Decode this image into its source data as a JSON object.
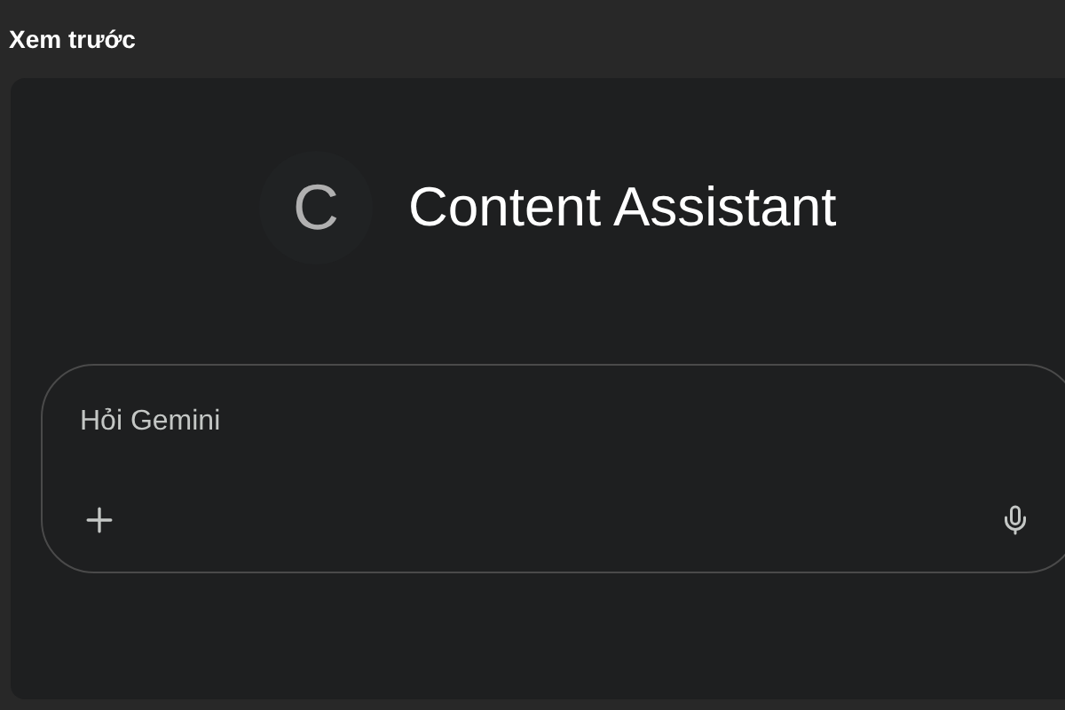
{
  "header": {
    "title": "Xem trước"
  },
  "assistant": {
    "avatar_letter": "C",
    "name": "Content Assistant"
  },
  "prompt": {
    "placeholder": "Hỏi Gemini"
  }
}
